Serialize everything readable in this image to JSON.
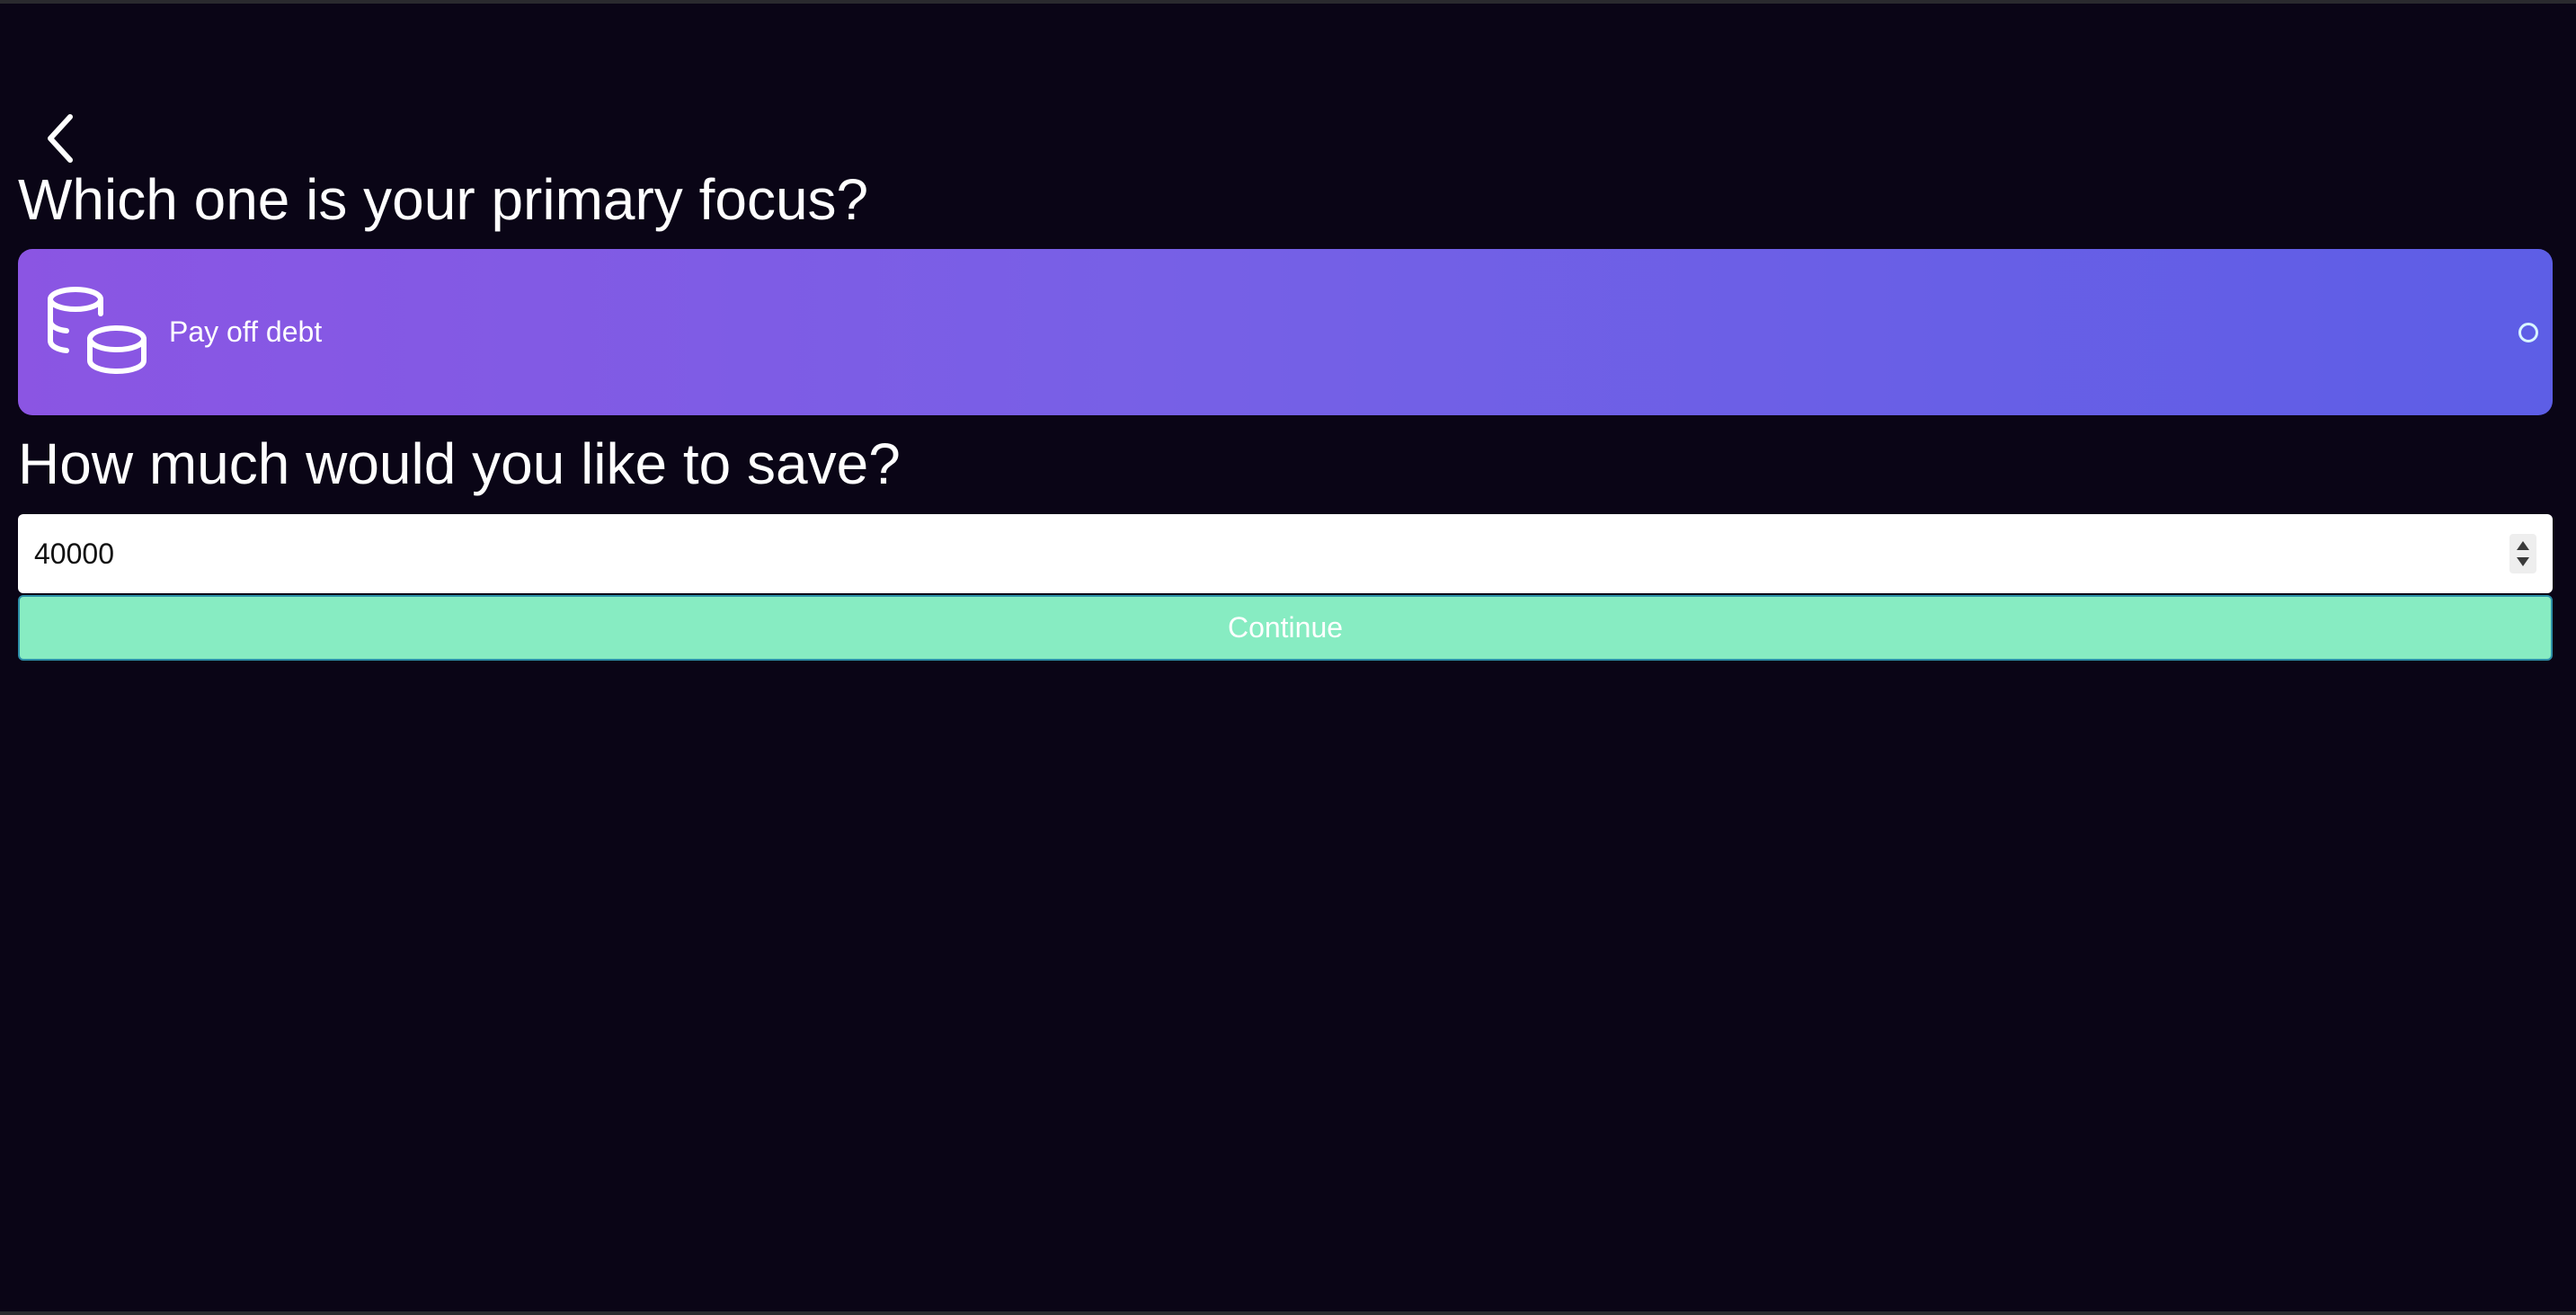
{
  "colors": {
    "background": "#0a0516",
    "card_gradient_start": "#8b55e3",
    "card_gradient_end": "#5d5ee6",
    "continue_button": "#87ecc2",
    "text": "#ffffff"
  },
  "nav": {
    "back_icon": "chevron-left-icon"
  },
  "focus_section": {
    "heading": "Which one is your primary focus?",
    "options": [
      {
        "label": "Pay off debt",
        "icon": "coins-icon",
        "selected": false
      }
    ]
  },
  "savings_section": {
    "heading": "How much would you like to save?",
    "amount_value": "40000"
  },
  "actions": {
    "continue_label": "Continue"
  }
}
